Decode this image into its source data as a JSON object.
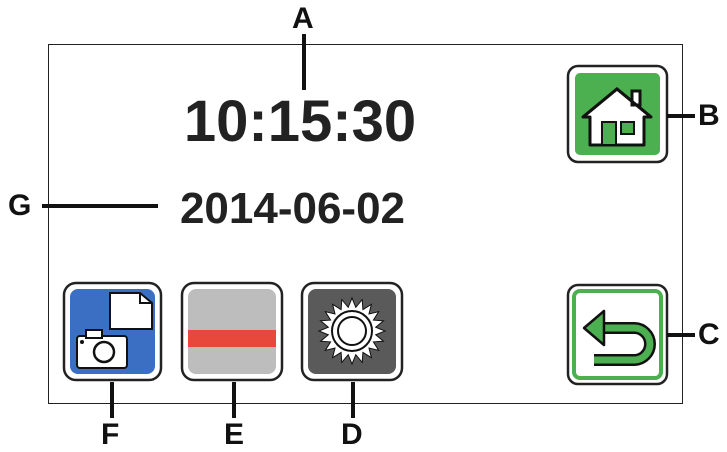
{
  "display": {
    "time": "10:15:30",
    "date": "2014-06-02"
  },
  "callouts": {
    "a": "A",
    "b": "B",
    "c": "C",
    "d": "D",
    "e": "E",
    "f": "F",
    "g": "G"
  },
  "buttons": {
    "home": {
      "icon": "home-icon",
      "color": "#4caf50"
    },
    "back": {
      "icon": "return-arrow-icon",
      "color": "#4caf50"
    },
    "media": {
      "icon": "camera-folder-icon",
      "color": "#3a6fc4"
    },
    "level": {
      "icon": "red-bar-icon",
      "color": "#e8483b"
    },
    "brightness": {
      "icon": "sun-icon",
      "color": "#5a5a5a"
    }
  }
}
